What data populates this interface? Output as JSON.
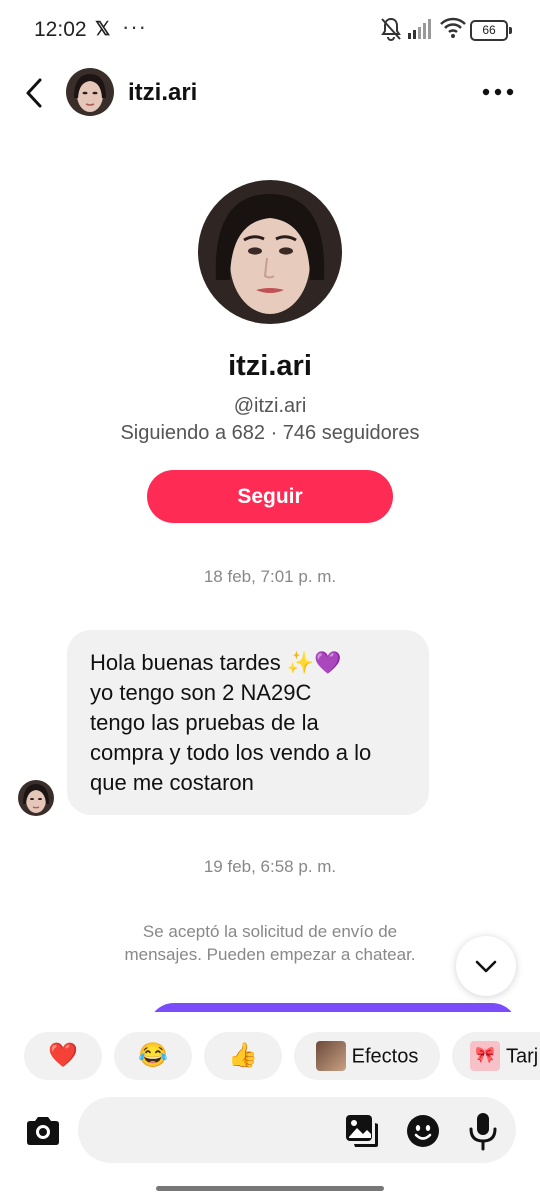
{
  "status_bar": {
    "time": "12:02",
    "x_app": "𝕏",
    "more": "···",
    "battery": "66",
    "icons": [
      "bell-off-icon",
      "signal-icon",
      "wifi-icon",
      "battery-icon"
    ]
  },
  "header": {
    "username": "itzi.ari",
    "icons": [
      "back-arrow-icon",
      "more-dots-icon"
    ]
  },
  "profile": {
    "name": "itzi.ari",
    "handle": "@itzi.ari",
    "stats": "Siguiendo a 682 · 746 seguidores",
    "follow_label": "Seguir"
  },
  "conversation": {
    "timestamp_1": "18 feb, 7:01 p. m.",
    "message_lines": [
      "Hola buenas tardes ✨💜",
      "yo tengo son 2 NA29C",
      "tengo las pruebas de la",
      "compra y todo los vendo a lo",
      "que me costaron"
    ],
    "timestamp_2": "19 feb, 6:58 p. m.",
    "system_line_1": "Se aceptó la solicitud de envío de",
    "system_line_2": "mensajes. Pueden empezar a chatear."
  },
  "quick_reactions": {
    "heart": "❤️",
    "laugh": "😂",
    "thumbs": "👍",
    "effects_label": "Efectos",
    "cards_label": "Tarj"
  },
  "composer": {
    "icons": [
      "camera-icon",
      "image-icon",
      "emoji-icon",
      "mic-icon"
    ]
  },
  "colors": {
    "follow_button": "#fe2c55",
    "bubble": "#f1f1f2",
    "sent_bubble": "#7b4dfa",
    "muted_text": "#888888"
  }
}
